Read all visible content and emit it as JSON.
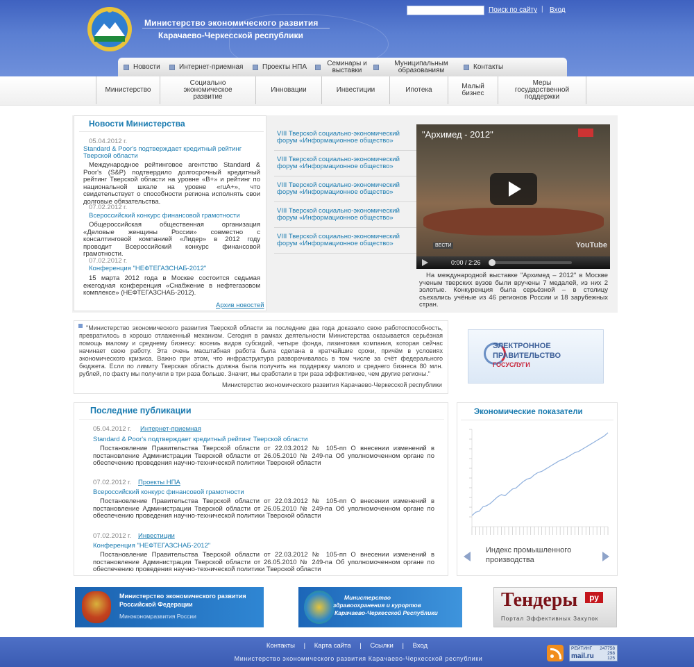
{
  "header": {
    "title_line1": "Министерство экономического развития",
    "title_line2": "Карачаево-Черкесской республики",
    "search_link": "Поиск по сайту",
    "separator": "|",
    "login": "Вход"
  },
  "topnav": [
    "Новости",
    "Интернет-приемная",
    "Проекты НПА",
    "Семинары и выставки",
    "Муниципальным образованиям",
    "Контакты"
  ],
  "subnav": [
    "Министерство",
    "Социально экономическое развитие",
    "Инновации",
    "Инвестиции",
    "Ипотека",
    "Малый бизнес",
    "Меры государственной поддержки"
  ],
  "news": {
    "title": "Новости Министерства",
    "items": [
      {
        "date": "05.04.2012 г.",
        "headline": "Standard & Poor's подтверждает кредитный рейтинг Тверской области",
        "text": "Международное рейтинговое агентство Standard & Poor's (S&P) подтвердило долгосрочный кредитный рейтинг Тверской области на уровне «B+» и рейтинг по национальной шкале на уровне «ruA+», что свидетельствует о способности региона исполнять свои долговые обязательства."
      },
      {
        "date": "07.02.2012 г.",
        "headline": "Всероссийский конкурс финансовой грамотности",
        "text": "Общероссийская общественная организация «Деловые женщины России» совместно с консалтинговой компанией «Лидер» в 2012 году проводит Всероссийский конкурс финансовой грамотности."
      },
      {
        "date": "07.02.2012 г.",
        "headline": "Конференция \"НЕФТЕГАЗСНАБ-2012\"",
        "text": "15 марта 2012 года в Москве состоится седьмая ежегодная конференция «Снабжение в нефтегазовом комплексе» (НЕФТЕГАЗСНАБ-2012)."
      }
    ],
    "archive": "Архив новостей"
  },
  "forum_items": [
    "VIII Тверской социально-экономический форум «Информационное общество»",
    "VIII Тверской социально-экономический форум «Информационное общество»",
    "VIII Тверской социально-экономический форум «Информационное общество»",
    "VIII Тверской социально-экономический форум «Информационное общество»",
    "VIII Тверской социально-экономический форум «Информационное общество»"
  ],
  "video": {
    "title": "\"Архимед - 2012\"",
    "time": "0:00 / 2:26",
    "youtube": "YouTube",
    "vesti": "ВЕСТИ",
    "caption": "На международной выставке \"Архимед – 2012\" в Москве ученым тверских вузов были вручены 7 медалей, из них 2 золотые. Конкуренция была серьёзной – в столицу съехались учёные из 46 регионов России и 18 зарубежных стран."
  },
  "quote": {
    "text": "\"Министерство экономического развития Тверской области за последние два года доказало свою работоспособность, превратилось в хорошо отлаженный механизм. Сегодня в рамках деятельности Министерства оказывается серьёзная помощь малому и среднему бизнесу: восемь видов субсидий, четыре фонда, лизинговая компания, которая сейчас начинает свою работу. Эта очень масштабная работа была сделана в кратчайшие сроки, причём в условиях экономического кризиса. Важно при этом, что инфраструктура разворачивалась в том числе за счёт федерального бюджета. Если по лимиту Тверская область должна была получить на поддержку малого и среднего бизнеса 80 млн. рублей, по факту мы получили в три раза больше. Значит, мы сработали в три раза эффективнее, чем другие регионы.\"",
    "author": "Министерство экономического развития Карачаево-Черкесской республики"
  },
  "gov_banner": {
    "line1": "ЭЛЕКТРОННОЕ",
    "line2": "ПРАВИТЕЛЬСТВО",
    "line3": "ГОСУСЛУГИ"
  },
  "publications": {
    "title": "Последние публикации",
    "items": [
      {
        "date": "05.04.2012 г.",
        "category": "Интернет-приемная",
        "headline": "Standard & Poor's подтверждает кредитный рейтинг Тверской области",
        "text": "Постановление Правительства Тверской области от 22.03.2012 № 105-пп О внесении изменений в постановление Администрации Тверской области от 26.05.2010 № 249-па Об уполномоченном органе по обеспечению проведения научно-технической политики Тверской области"
      },
      {
        "date": "07.02.2012 г.",
        "category": "Проекты НПА",
        "headline": "Всероссийский конкурс финансовой грамотности",
        "text": "Постановление Правительства Тверской области от 22.03.2012 № 105-пп О внесении изменений в постановление Администрации Тверской области от 26.05.2010 № 249-па Об уполномоченном органе по обеспечению проведения научно-технической политики Тверской области"
      },
      {
        "date": "07.02.2012 г.",
        "category": "Инвестиции",
        "headline": "Конференция \"НЕФТЕГАЗСНАБ-2012\"",
        "text": "Постановление Правительства Тверской области от 22.03.2012 № 105-пп О внесении изменений в постановление Администрации Тверской области от 26.05.2010 № 249-па Об уполномоченном органе по обеспечению проведения научно-технической политики Тверской области"
      }
    ]
  },
  "economy": {
    "title": "Экономические показатели",
    "label": "Индекс промышленного производства"
  },
  "chart_data": {
    "type": "line",
    "title": "",
    "xlabel": "",
    "ylabel": "",
    "series": [
      {
        "values": [
          100,
          103,
          104,
          108,
          109,
          111,
          114,
          117,
          119,
          118,
          121,
          124,
          125,
          128,
          131,
          133,
          134,
          137,
          139,
          140,
          142,
          144,
          146,
          148,
          150,
          151,
          153,
          155,
          157,
          158,
          160,
          162,
          164,
          166,
          168,
          170,
          172,
          175
        ]
      }
    ],
    "grid": false
  },
  "banners": {
    "minek_l1": "Министерство экономического развития",
    "minek_l2": "Российской Федерации",
    "minek_l3": "Минэкономразвития России",
    "health_l1": "Министерство",
    "health_l2": "здравоохранения и курортов",
    "health_l3": "Карачаево-Черкесской Республики",
    "tender_word": "Тендеры",
    "tender_ru": "ру",
    "tender_sub": "Портал Эффективных Закупок"
  },
  "footer": {
    "links": [
      "Контакты",
      "Карта сайта",
      "Ссылки",
      "Вход"
    ],
    "separator": "|",
    "copy": "Министерство экономического развития Карачаево-Черкесской республики",
    "counter": {
      "rating": "РЕЙТИНГ",
      "v1": "247758",
      "v2": "298",
      "v3": "125",
      "logo": "mail.ru"
    }
  },
  "colors": {
    "brand_blue": "#4a6cc4",
    "link": "#1a7bb0",
    "chart_line": "#8fb0dd"
  }
}
